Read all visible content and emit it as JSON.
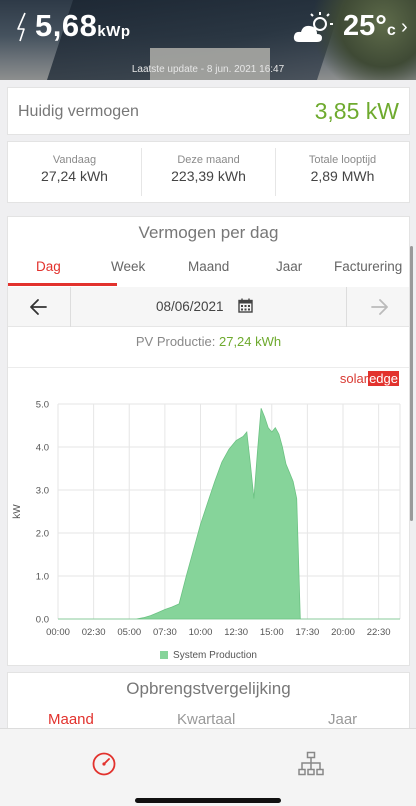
{
  "header": {
    "power_value": "5,68",
    "power_unit": "kWp",
    "temperature": "25°",
    "temperature_unit": "c",
    "chevron": "›",
    "last_update": "Laatste update - 8 jun. 2021 16:47",
    "weather_icon": "partly-sunny-icon"
  },
  "current": {
    "label": "Huidig vermogen",
    "value": "3,85 kW"
  },
  "stats": [
    {
      "label": "Vandaag",
      "value": "27,24 kWh"
    },
    {
      "label": "Deze maand",
      "value": "223,39 kWh"
    },
    {
      "label": "Totale looptijd",
      "value": "2,89 MWh"
    }
  ],
  "power_per_day": {
    "title": "Vermogen per dag",
    "tabs": [
      "Dag",
      "Week",
      "Maand",
      "Jaar",
      "Facturering"
    ],
    "active_tab": "Dag",
    "date": "08/06/2021",
    "pv_label": "PV Productie:",
    "pv_value": "27,24 kWh"
  },
  "logo": {
    "part1": "solar",
    "part2": "edge"
  },
  "chart_data": {
    "type": "area",
    "ylabel": "kW",
    "xlabel": "",
    "ylim": [
      0,
      5
    ],
    "y_ticks": [
      "0.0",
      "1.0",
      "2.0",
      "3.0",
      "4.0",
      "5.0"
    ],
    "x_ticks": [
      "00:00",
      "02:30",
      "05:00",
      "07:30",
      "10:00",
      "12:30",
      "15:00",
      "17:30",
      "20:00",
      "22:30"
    ],
    "grid": true,
    "legend_position": "bottom",
    "series": [
      {
        "name": "System Production",
        "color": "#86d49a",
        "x": [
          "00:00",
          "05:30",
          "06:00",
          "06:30",
          "07:00",
          "07:30",
          "08:00",
          "08:30",
          "09:00",
          "09:30",
          "10:00",
          "10:30",
          "11:00",
          "11:30",
          "12:00",
          "12:30",
          "13:00",
          "13:15",
          "13:30",
          "13:45",
          "14:00",
          "14:15",
          "14:30",
          "14:45",
          "15:00",
          "15:15",
          "15:30",
          "15:45",
          "16:00",
          "16:15",
          "16:30",
          "16:45",
          "17:00",
          "24:00"
        ],
        "values": [
          0,
          0,
          0.03,
          0.08,
          0.15,
          0.22,
          0.28,
          0.35,
          1.0,
          1.6,
          2.2,
          2.7,
          3.2,
          3.65,
          3.95,
          4.15,
          4.25,
          4.35,
          3.6,
          2.8,
          3.9,
          4.9,
          4.7,
          4.45,
          4.35,
          4.45,
          4.3,
          4.0,
          3.6,
          3.4,
          3.2,
          2.8,
          0,
          0
        ]
      }
    ]
  },
  "comparison": {
    "title": "Opbrengstvergelijking",
    "tabs": [
      "Maand",
      "Kwartaal",
      "Jaar"
    ],
    "active_tab": "Maand"
  },
  "bottom_nav": [
    {
      "name": "dashboard-icon"
    },
    {
      "name": "layout-icon"
    }
  ]
}
